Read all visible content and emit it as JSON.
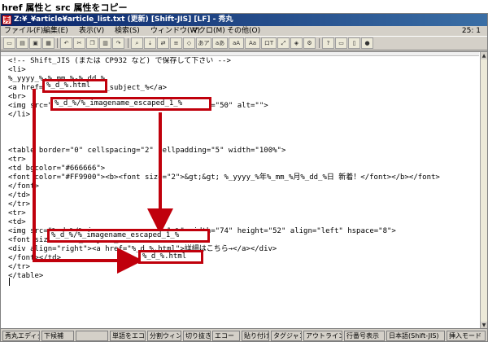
{
  "caption": "href 属性と src 属性をコピー",
  "window": {
    "title": "Z:¥_¥article¥article_list.txt (更新) [Shift-JIS] [LF] - 秀丸",
    "menu": [
      "ファイル(F)",
      "編集(E)",
      "表示(V)",
      "検索(S)",
      "ウィンドウ(W)",
      "マクロ(M)",
      "その他(O)"
    ],
    "cursor_pos": "25: 1"
  },
  "toolbar": {
    "buttons": [
      "new-file-icon",
      "open-folder-icon",
      "save-icon",
      "print-icon",
      "undo-icon",
      "cut-icon",
      "copy-icon",
      "paste-icon",
      "redo-icon",
      "search-icon",
      "search-next-icon",
      "replace-icon",
      "grep-icon",
      "case-icon",
      "wide-icon",
      "jump-icon",
      "bookmark-icon",
      "settings-icon",
      "help-icon",
      "window-icon"
    ],
    "text_buttons": [
      "あア",
      "aあ",
      "aA",
      "Aa",
      "ロT"
    ]
  },
  "editor": {
    "lines": [
      "<!-- Shift_JIS (または CP932 など) で保存して下さい -->",
      "<li>",
      "%_yyyy_%-%_mm_%-%_dd_%",
      "<a href=\"%_d_%.html\">%_subject_%</a>",
      "<br>",
      "<img src=\"%_d_%/%_imagename_escaped_1_%\" width=\"50\" alt=\"\">",
      "</li>",
      "",
      "",
      "",
      "<table border=\"0\" cellspacing=\"2\" cellpadding=\"5\" width=\"100%\">",
      "<tr>",
      "<td bgcolor=\"#666666\">",
      "<font color=\"#FF9900\"><b><font size=\"2\">&gt;&gt; %_yyyy_%年%_mm_%月%_dd_%日 新着！</font></b></font>",
      "</font>",
      "</td>",
      "</tr>",
      "<tr>",
      "<td>",
      "<img src=\"%_d_%/%_imagename_escaped_1_%\" width=\"74\" height=\"52\" align=\"left\" hspace=\"8\">",
      "<font size=\"2\">%_subject_%</font>",
      "<div align=\"right\"><a href=\"%_d_%.html\">詳細はこちら→</a></div>",
      "</font></td>",
      "</tr>",
      "</table>"
    ],
    "highlights": [
      "%_d_%.html",
      "%_d_%/%_imagename_escaped_1_%",
      "%_d_%/%_imagename_escaped_1_%",
      "%_d_%.html"
    ]
  },
  "statusbar": {
    "keys": [
      "秀丸エディタ",
      "下候補",
      "",
      "単語をエコー",
      "分割ウィンドウ",
      "切り抜き",
      "エコー",
      "貼り付け",
      "タグジャンプ",
      "アウトライン解析",
      "行番号表示",
      "日本語(Shift-JIS)",
      "挿入モード"
    ]
  },
  "colors": {
    "annotation": "#c0000c",
    "titlebar": "#0a246a"
  }
}
